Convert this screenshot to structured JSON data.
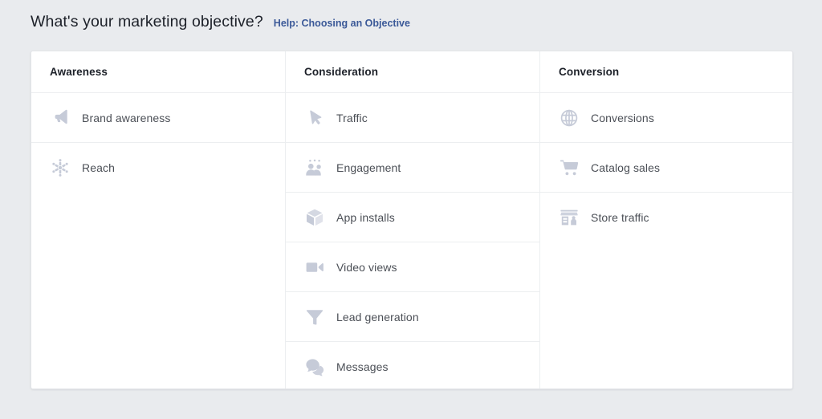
{
  "header": {
    "title": "What's your marketing objective?",
    "help_link": "Help: Choosing an Objective"
  },
  "colors": {
    "page_background": "#e9ebee",
    "card_background": "#ffffff",
    "divider": "#eceef0",
    "title_text": "#1d2129",
    "label_text": "#4b4f56",
    "link_blue": "#3b5998",
    "icon_fill": "#c6cbd8"
  },
  "columns": [
    {
      "header": "Awareness",
      "items": [
        {
          "label": "Brand awareness",
          "icon": "megaphone-icon"
        },
        {
          "label": "Reach",
          "icon": "reach-burst-icon"
        }
      ]
    },
    {
      "header": "Consideration",
      "items": [
        {
          "label": "Traffic",
          "icon": "cursor-arrow-icon"
        },
        {
          "label": "Engagement",
          "icon": "people-group-icon"
        },
        {
          "label": "App installs",
          "icon": "cube-box-icon"
        },
        {
          "label": "Video views",
          "icon": "video-camera-icon"
        },
        {
          "label": "Lead generation",
          "icon": "funnel-icon"
        },
        {
          "label": "Messages",
          "icon": "speech-bubbles-icon"
        }
      ]
    },
    {
      "header": "Conversion",
      "items": [
        {
          "label": "Conversions",
          "icon": "globe-icon"
        },
        {
          "label": "Catalog sales",
          "icon": "shopping-cart-icon"
        },
        {
          "label": "Store traffic",
          "icon": "storefront-icon"
        }
      ]
    }
  ]
}
